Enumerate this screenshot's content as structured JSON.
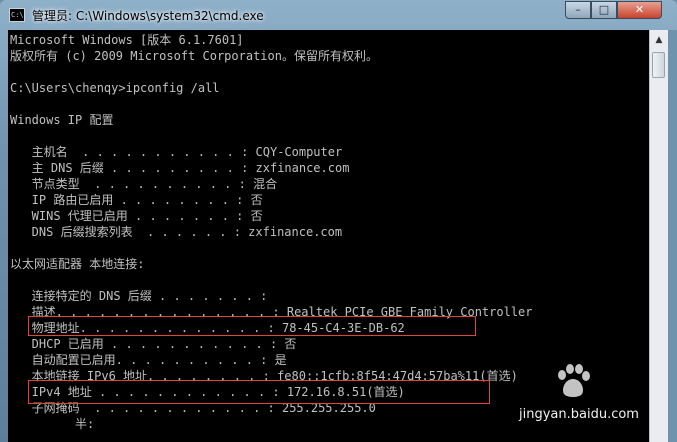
{
  "window": {
    "title": "管理员: C:\\Windows\\system32\\cmd.exe",
    "icon_text": "C:\\"
  },
  "controls": {
    "minimize": "–",
    "maximize": "□",
    "close": "✕"
  },
  "console": {
    "lines": [
      "Microsoft Windows [版本 6.1.7601]",
      "版权所有 (c) 2009 Microsoft Corporation。保留所有权利。",
      "",
      "C:\\Users\\chenqy>ipconfig /all",
      "",
      "Windows IP 配置",
      "",
      "   主机名  . . . . . . . . . . . : CQY-Computer",
      "   主 DNS 后缀 . . . . . . . . . : zxfinance.com",
      "   节点类型  . . . . . . . . . . : 混合",
      "   IP 路由已启用 . . . . . . . . : 否",
      "   WINS 代理已启用 . . . . . . . : 否",
      "   DNS 后缀搜索列表  . . . . . . : zxfinance.com",
      "",
      "以太网适配器 本地连接:",
      "",
      "   连接特定的 DNS 后缀 . . . . . . . :",
      "   描述. . . . . . . . . . . . . . . : Realtek PCIe GBE Family Controller",
      "   物理地址. . . . . . . . . . . . . : 78-45-C4-3E-DB-62",
      "   DHCP 已启用 . . . . . . . . . . . : 否",
      "   自动配置已启用. . . . . . . . . . : 是",
      "   本地链接 IPv6 地址. . . . . . . . : fe80::1cfb:8f54:47d4:57ba%11(首选)",
      "   IPv4 地址 . . . . . . . . . . . . : 172.16.8.51(首选)",
      "   子网掩码  . . . . . . . . . . . . : 255.255.255.0",
      "         半:"
    ]
  },
  "watermark": {
    "text": "jingyan.baidu.com"
  },
  "colors": {
    "console_bg": "#000000",
    "console_text": "#c0c0c0",
    "highlight_box": "#e0453a"
  }
}
